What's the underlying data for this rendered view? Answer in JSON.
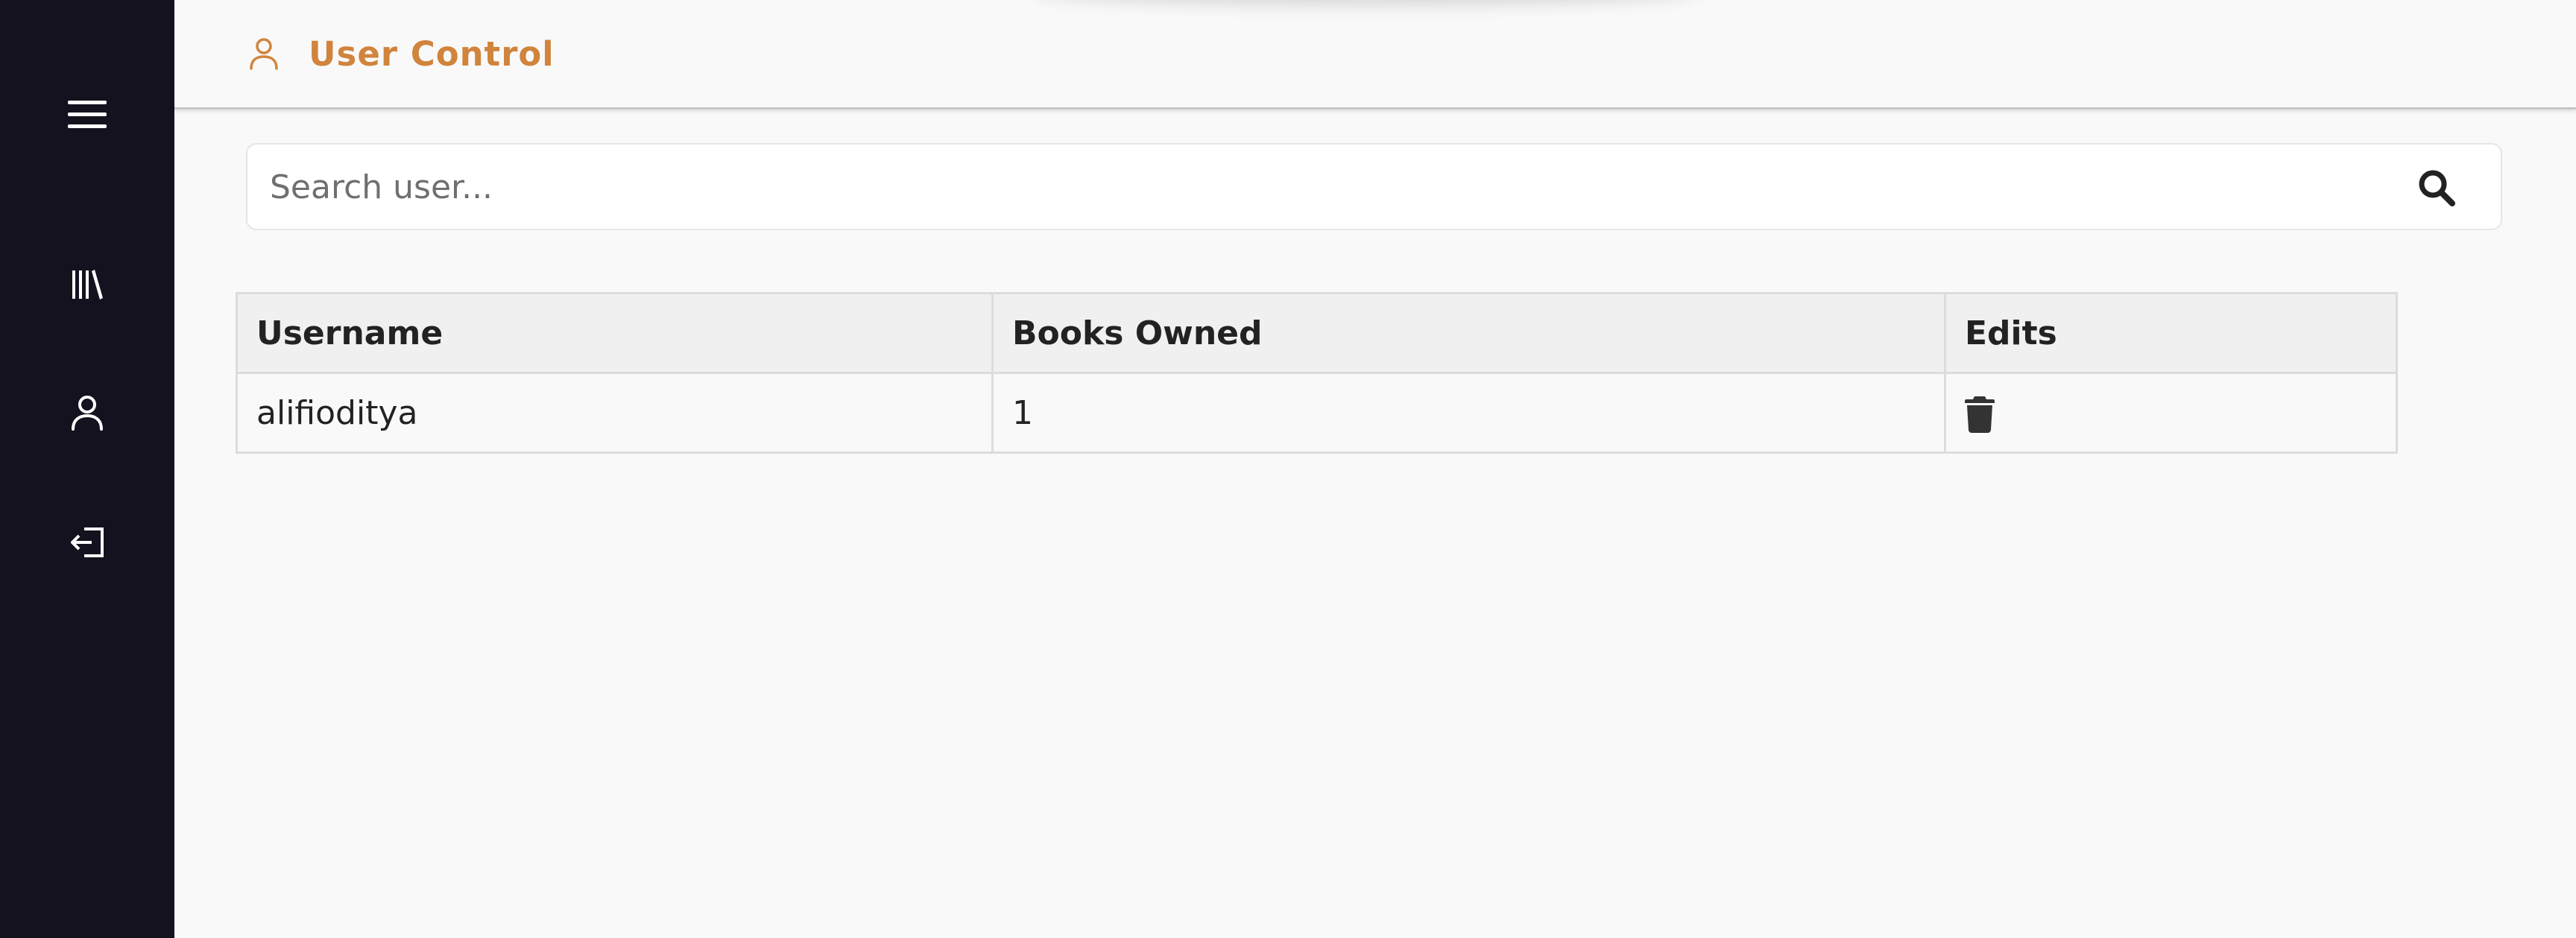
{
  "sidebar": {
    "items": [
      {
        "name": "menu",
        "icon": "hamburger-menu-icon"
      },
      {
        "name": "library",
        "icon": "library-icon"
      },
      {
        "name": "users",
        "icon": "user-icon"
      },
      {
        "name": "logout",
        "icon": "logout-icon"
      }
    ]
  },
  "header": {
    "title": "User Control",
    "title_icon": "user-icon",
    "accent_color": "#d0843c"
  },
  "search": {
    "placeholder": "Search user...",
    "value": "",
    "icon": "search-icon"
  },
  "table": {
    "columns": [
      "Username",
      "Books Owned",
      "Edits"
    ],
    "rows": [
      {
        "username": "alifioditya",
        "books_owned": "1",
        "edit_icon": "trash-icon"
      }
    ]
  },
  "colors": {
    "sidebar_bg": "#15121f",
    "page_bg": "#f9f9f9"
  }
}
